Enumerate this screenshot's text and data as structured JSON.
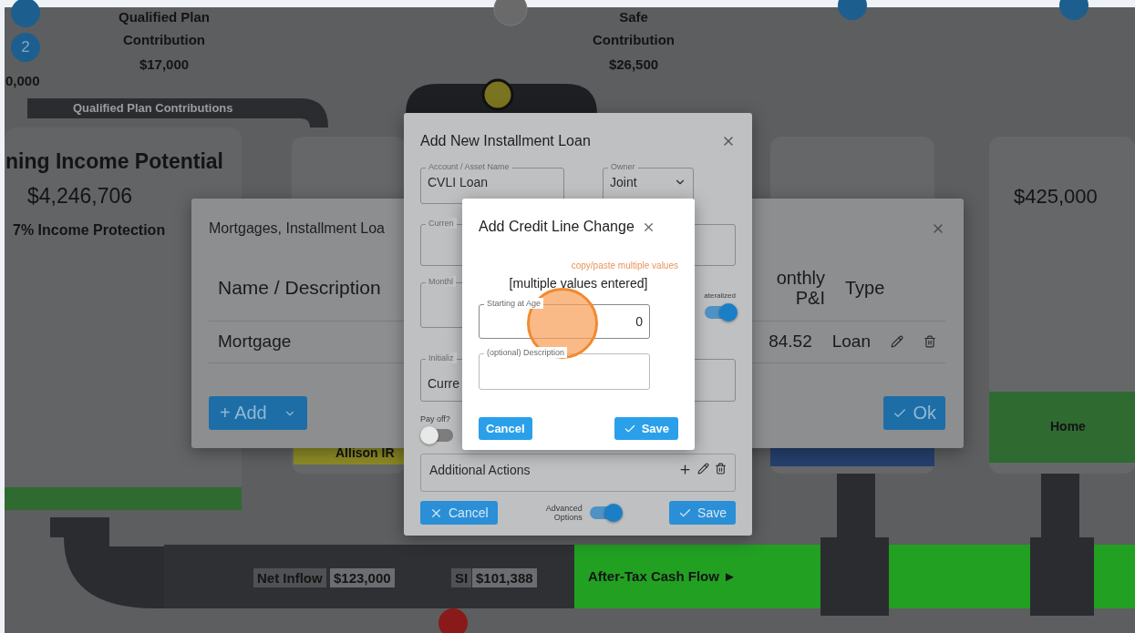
{
  "background": {
    "step_badge": "2",
    "partial_amount": "0,000",
    "qualified_plan": {
      "lines": [
        "Qualified Plan",
        "Contribution"
      ],
      "amount": "$17,000"
    },
    "pipe_label": "Qualified Plan Contributions",
    "income_panel": {
      "title": "ning Income Potential",
      "amount": "$4,246,706",
      "subtitle": "7% Income Protection"
    },
    "safe": {
      "lines": [
        "Safe",
        "Contribution"
      ],
      "amount": "$26,500"
    },
    "tank_amount": "$425,000",
    "tank_labels": [
      "Allison IR",
      "Home"
    ],
    "flow": [
      {
        "label": "Net Inflow",
        "amount": "$123,000"
      },
      {
        "label": "SI",
        "amount": "$101,388"
      }
    ],
    "cash_flow_label": "After-Tax Cash Flow ►"
  },
  "mortgages_dialog": {
    "title": "Mortgages, Installment Loa",
    "columns": [
      "Name / Description",
      "onthly\nP&I",
      "Type"
    ],
    "rows": [
      {
        "name": "Mortgage",
        "monthly": "84.52",
        "type": "Loan"
      }
    ],
    "add_button": "+ Add",
    "ok_button": "Ok"
  },
  "installment_dialog": {
    "title": "Add New Installment Loan",
    "fields": [
      {
        "label": "Account / Asset Name",
        "value": "CVLI Loan"
      },
      {
        "label": "Owner",
        "value": "Joint"
      },
      {
        "label": "Curren"
      },
      {
        "label": "Monthl"
      },
      {
        "label": "Initializ",
        "value": "Curre"
      }
    ],
    "collateralized": {
      "label": "ateralized",
      "on": true
    },
    "pay_off": {
      "label": "Pay off?",
      "on": false
    },
    "additional_actions": "Additional Actions",
    "cancel_button": "Cancel",
    "advanced_options": {
      "label": "Advanced\nOptions",
      "on": true
    },
    "save_button": "Save"
  },
  "credit_line_dialog": {
    "title": "Add Credit Line Change",
    "hint_link": "copy/paste multiple values",
    "status": "[multiple values entered]",
    "fields": [
      {
        "label": "Starting at Age",
        "value": "0"
      },
      {
        "label": "(optional) Description"
      }
    ],
    "cancel_button": "Cancel",
    "save_button": "Save"
  }
}
